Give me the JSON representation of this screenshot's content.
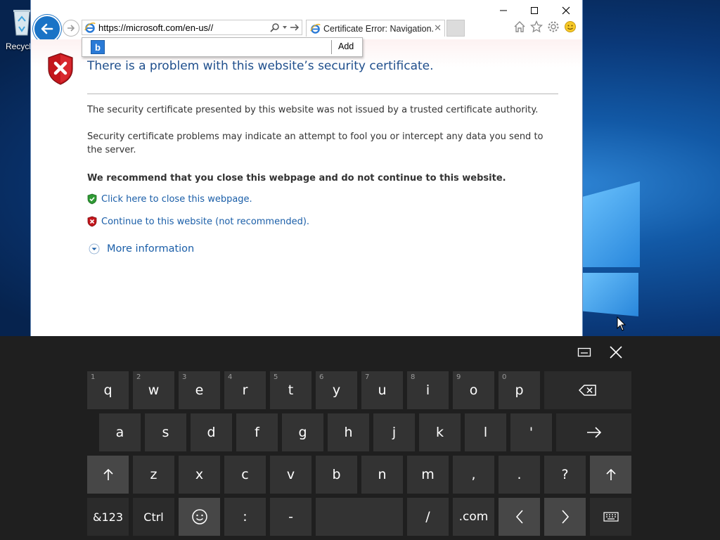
{
  "desktop": {
    "recycle_label": "Recycl"
  },
  "browser": {
    "address_url": "https://microsoft.com/en-us//",
    "tab_title": "Certificate Error: Navigation...",
    "suggest_add_label": "Add",
    "bing_letter": "b"
  },
  "page": {
    "title": "There is a problem with this website’s security certificate.",
    "para1": "The security certificate presented by this website was not issued by a trusted certificate authority.",
    "para2": "Security certificate problems may indicate an attempt to fool you or intercept any data you send to the server.",
    "recommend": "We recommend that you close this webpage and do not continue to this website.",
    "close_link": "Click here to close this webpage.",
    "continue_link": "Continue to this website (not recommended).",
    "more_info": "More information"
  },
  "keyboard": {
    "row1": [
      {
        "label": "q",
        "num": "1"
      },
      {
        "label": "w",
        "num": "2"
      },
      {
        "label": "e",
        "num": "3"
      },
      {
        "label": "r",
        "num": "4"
      },
      {
        "label": "t",
        "num": "5"
      },
      {
        "label": "y",
        "num": "6"
      },
      {
        "label": "u",
        "num": "7"
      },
      {
        "label": "i",
        "num": "8"
      },
      {
        "label": "o",
        "num": "9"
      },
      {
        "label": "p",
        "num": "0"
      }
    ],
    "row2": [
      "a",
      "s",
      "d",
      "f",
      "g",
      "h",
      "j",
      "k",
      "l",
      "'"
    ],
    "row3": [
      "z",
      "x",
      "c",
      "v",
      "b",
      "n",
      "m",
      ",",
      ".",
      "?"
    ],
    "row4": {
      "sym": "&123",
      "ctrl": "Ctrl",
      "colon": ":",
      "dash": "-",
      "slash": "/",
      "dotcom": ".com"
    }
  },
  "colors": {
    "link": "#1a5ea8",
    "title": "#1f4e8c",
    "back_button": "#1a73c6",
    "key_bg": "#333333",
    "keyboard_bg": "#1f1f1f"
  }
}
